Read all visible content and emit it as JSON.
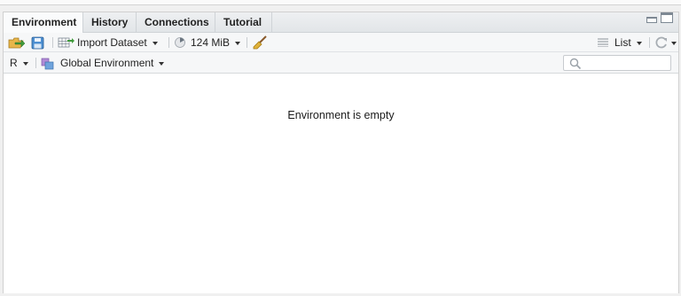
{
  "tabs": [
    {
      "label": "Environment"
    },
    {
      "label": "History"
    },
    {
      "label": "Connections"
    },
    {
      "label": "Tutorial"
    }
  ],
  "toolbar": {
    "import_label": "Import Dataset",
    "memory_label": "124 MiB",
    "view_label": "List"
  },
  "env_bar": {
    "language": "R",
    "scope": "Global Environment"
  },
  "content": {
    "empty_message": "Environment is empty"
  }
}
